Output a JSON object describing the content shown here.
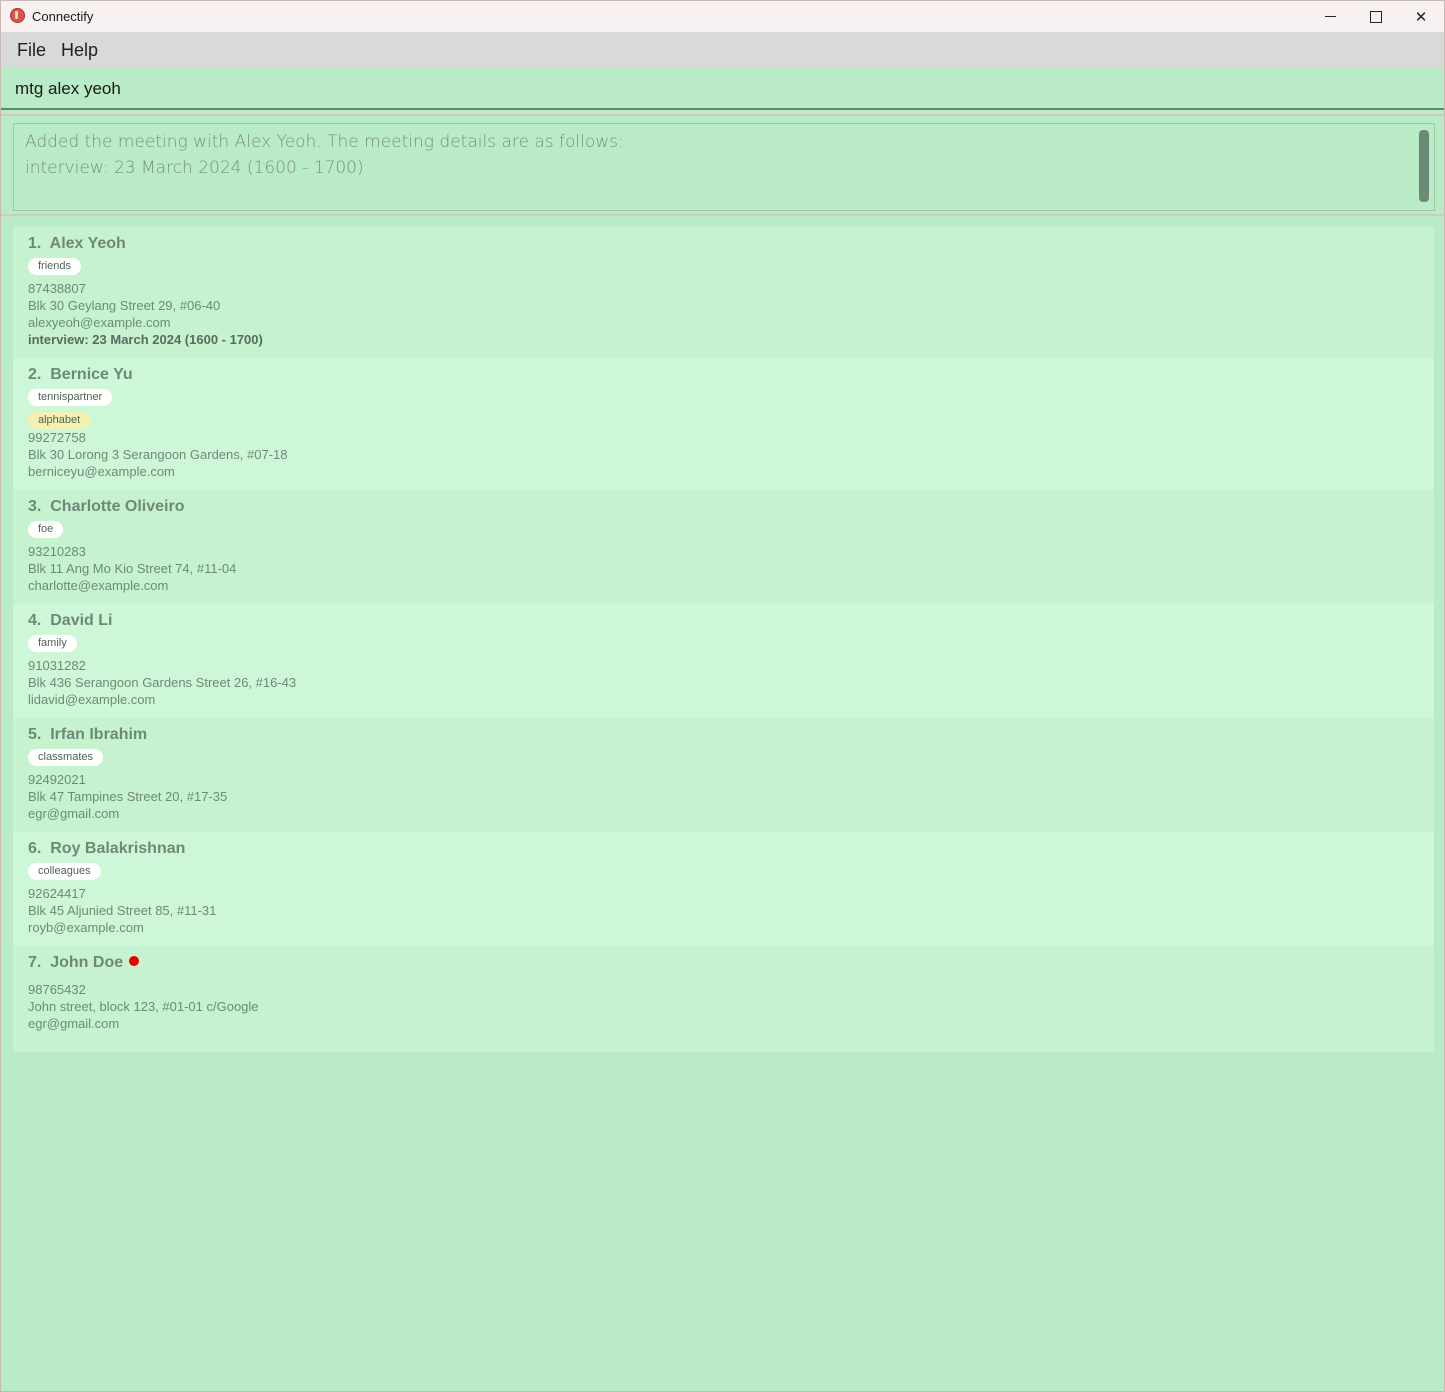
{
  "window": {
    "title": "Connectify",
    "controls": {
      "minimize": "minimize-icon",
      "maximize": "maximize-icon",
      "close": "close-icon"
    }
  },
  "menu": {
    "file": "File",
    "help": "Help"
  },
  "command": {
    "value": "mtg alex yeoh"
  },
  "result": {
    "line1": "Added the meeting with Alex Yeoh. The meeting details are as follows:",
    "line2": "interview: 23 March 2024 (1600 - 1700)"
  },
  "persons": [
    {
      "index": "1.",
      "name": "Alex Yeoh",
      "tags": [
        "friends"
      ],
      "phone": "87438807",
      "address": "Blk 30 Geylang Street 29, #06-40",
      "email": "alexyeoh@example.com",
      "meeting": "interview: 23 March 2024 (1600 - 1700)"
    },
    {
      "index": "2.",
      "name": "Bernice Yu",
      "tags": [
        "tennispartner"
      ],
      "extra_tag": "alphabet",
      "phone": "99272758",
      "address": "Blk 30 Lorong 3 Serangoon Gardens, #07-18",
      "email": "berniceyu@example.com"
    },
    {
      "index": "3.",
      "name": "Charlotte Oliveiro",
      "tags": [
        "foe"
      ],
      "phone": "93210283",
      "address": "Blk 11 Ang Mo Kio Street 74, #11-04",
      "email": "charlotte@example.com"
    },
    {
      "index": "4.",
      "name": "David Li",
      "tags": [
        "family"
      ],
      "phone": "91031282",
      "address": "Blk 436 Serangoon Gardens Street 26, #16-43",
      "email": "lidavid@example.com"
    },
    {
      "index": "5.",
      "name": "Irfan Ibrahim",
      "tags": [
        "classmates"
      ],
      "phone": "92492021",
      "address": "Blk 47 Tampines Street 20, #17-35",
      "email": "egr@gmail.com"
    },
    {
      "index": "6.",
      "name": "Roy Balakrishnan",
      "tags": [
        "colleagues"
      ],
      "phone": "92624417",
      "address": "Blk 45 Aljunied Street 85, #11-31",
      "email": "royb@example.com"
    },
    {
      "index": "7.",
      "name": "John Doe",
      "tags": [],
      "phone": "98765432",
      "address": "John street, block 123, #01-01 c/Google",
      "email": "egr@gmail.com"
    }
  ],
  "colors": {
    "background": "#b8ebc6",
    "card": "#c6f2d0",
    "card_alt": "#cdf7d7",
    "tag_yellow": "#f3f1b2",
    "status_dot": "#e60000"
  }
}
